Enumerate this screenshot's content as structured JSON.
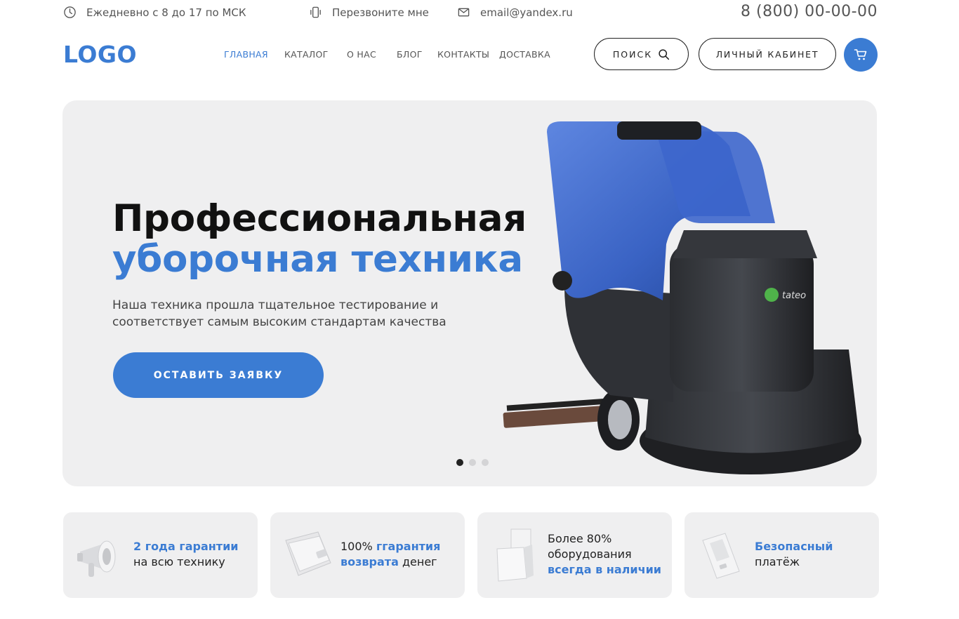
{
  "topbar": {
    "hours": "Ежедневно с 8 до 17 по МСК",
    "callback": "Перезвоните мне",
    "email": "email@yandex.ru",
    "phone": "8 (800) 00-00-00"
  },
  "header": {
    "logo": "LOGO",
    "nav": [
      {
        "label": "ГЛАВНАЯ",
        "active": true
      },
      {
        "label": "КАТАЛОГ",
        "active": false
      },
      {
        "label": "О НАС",
        "active": false
      },
      {
        "label": "БЛОГ",
        "active": false
      },
      {
        "label": "КОНТАКТЫ",
        "active": false
      },
      {
        "label": "ДОСТАВКА",
        "active": false
      }
    ],
    "search_label": "ПОИСК",
    "account_label": "ЛИЧНЫЙ КАБИНЕТ"
  },
  "hero": {
    "title_line1": "Профессиональная",
    "title_line2": "уборочная техника",
    "subtitle": "Наша техника прошла тщательное тестирование и соответствует самым высоким стандартам качества",
    "cta": "ОСТАВИТЬ ЗАЯВКУ",
    "slides_count": 3,
    "active_slide": 1,
    "machine_brand": "tateo"
  },
  "features": [
    {
      "icon": "megaphone-icon",
      "parts": [
        [
          "2 года гарантии",
          "b"
        ],
        [
          "\nна всю технику",
          "k"
        ]
      ]
    },
    {
      "icon": "wallet-icon",
      "parts": [
        [
          "100% ",
          "k"
        ],
        [
          "гарантия\nвозврата",
          "b"
        ],
        [
          " денег",
          "k"
        ]
      ]
    },
    {
      "icon": "boxes-icon",
      "parts": [
        [
          "Более 80%\nоборудования\n",
          "k"
        ],
        [
          "всегда в наличии",
          "b"
        ]
      ]
    },
    {
      "icon": "card-reader-icon",
      "parts": [
        [
          "Безопасный",
          "b"
        ],
        [
          "\nплатёж",
          "k"
        ]
      ]
    }
  ],
  "colors": {
    "accent": "#3b7cd3",
    "panel": "#efeff0",
    "text": "#222222"
  }
}
